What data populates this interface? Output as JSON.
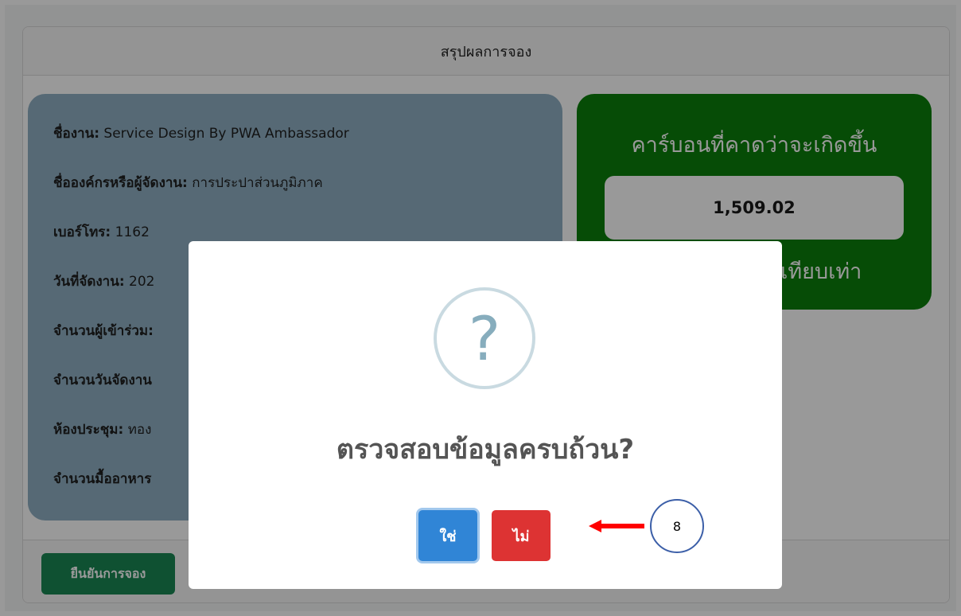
{
  "card": {
    "header_title": "สรุปผลการจอง"
  },
  "info": {
    "lines": [
      {
        "label": "ชื่องาน:",
        "value": " Service Design By PWA Ambassador"
      },
      {
        "label": "ชื่อองค์กรหรือผู้จัดงาน:",
        "value": " การประปาส่วนภูมิภาค"
      },
      {
        "label": "เบอร์โทร:",
        "value": " 1162"
      },
      {
        "label": "วันที่จัดงาน:",
        "value": " 202"
      },
      {
        "label": "จำนวนผู้เข้าร่วม:",
        "value": ""
      },
      {
        "label": "จำนวนวันจัดงาน",
        "value": ""
      },
      {
        "label": "ห้องประชุม:",
        "value": " ทอง"
      },
      {
        "label": "จำนวนมื้ออาหาร",
        "value": ""
      }
    ]
  },
  "carbon": {
    "title": "คาร์บอนที่คาดว่าจะเกิดขึ้น",
    "value": "1,509.02",
    "unit_partial": "นเทียบเท่า"
  },
  "footer": {
    "confirm_label": "ยืนยันการจอง"
  },
  "modal": {
    "icon": "question-icon",
    "icon_glyph": "?",
    "title": "ตรวจสอบข้อมูลครบถ้วน?",
    "yes_label": "ใช่",
    "no_label": "ไม่"
  },
  "annotation": {
    "step_number": "8"
  },
  "colors": {
    "info_bg": "#8fb0c4",
    "carbon_bg": "#0b7f0b",
    "confirm_btn": "#198754",
    "yes_btn": "#3085d6",
    "no_btn": "#dd3333",
    "arrow": "#ff0000"
  }
}
